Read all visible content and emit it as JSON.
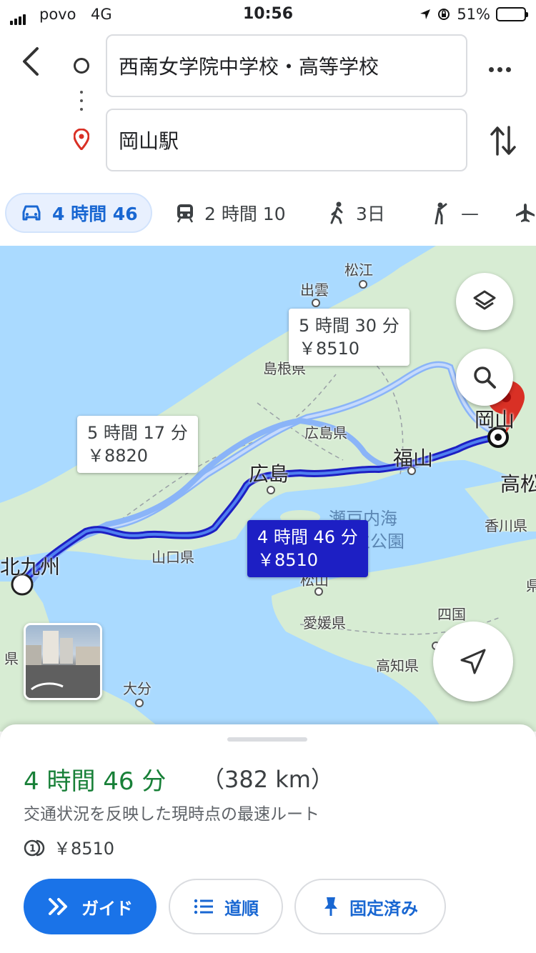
{
  "status_bar": {
    "carrier": "povo",
    "network": "4G",
    "time": "10:56",
    "battery": "51%",
    "battery_level": 0.51
  },
  "route": {
    "origin": "西南女学院中学校・高等学校",
    "destination": "岡山駅"
  },
  "modes": [
    {
      "icon": "car-icon",
      "label": "4 時間 46",
      "active": true
    },
    {
      "icon": "train-icon",
      "label": "2 時間 10"
    },
    {
      "icon": "walk-icon",
      "label": "3日"
    },
    {
      "icon": "ride-icon",
      "label": "—"
    },
    {
      "icon": "plane-icon",
      "label": ""
    }
  ],
  "map": {
    "labels": {
      "matsue": "松江",
      "izumo": "出雲",
      "shimane": "島根県",
      "hiroshima_pref": "広島県",
      "hiroshima": "広島",
      "fukuyama": "福山",
      "okayama": "岡山",
      "takamatsu": "高松",
      "kagawa": "香川県",
      "setonaikai": "瀬戸内海",
      "koen": "国立公園",
      "yamaguchi": "山口県",
      "kitakyushu": "北九州",
      "matsuyama": "松山",
      "ehime": "愛媛県",
      "shikoku": "四国",
      "kochi": "高知県",
      "oita": "大分",
      "ken_left": "県",
      "ken_right": "県"
    },
    "callouts": {
      "north": {
        "time": "5 時間 30 分",
        "toll": "￥8510"
      },
      "middle": {
        "time": "5 時間 17 分",
        "toll": "￥8820"
      },
      "selected": {
        "time": "4 時間 46 分",
        "toll": "￥8510"
      }
    }
  },
  "summary": {
    "duration": "4 時間 46 分",
    "distance": "（382 km）",
    "note": "交通状況を反映した現時点の最速ルート",
    "toll": "￥8510"
  },
  "buttons": {
    "guide": "ガイド",
    "steps": "道順",
    "pinned": "固定済み"
  },
  "colors": {
    "accent": "#1a73e8",
    "route_primary": "#1d1fc4",
    "duration_green": "#188038",
    "pin_red": "#d93025"
  }
}
